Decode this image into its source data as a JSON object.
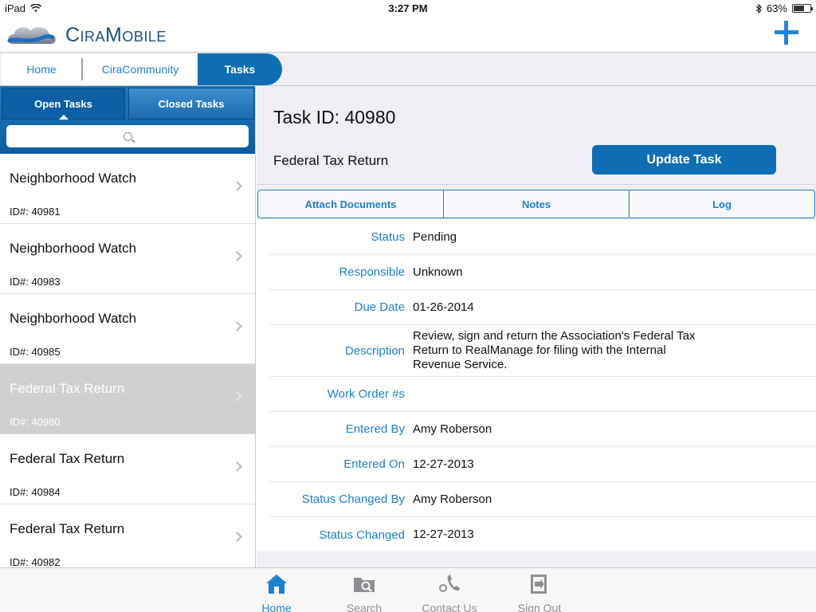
{
  "status_bar": {
    "device": "iPad",
    "time": "3:27 PM",
    "battery": "63%",
    "battery_level": 0.63
  },
  "app": {
    "name": "CiraMobile"
  },
  "top_tabs": [
    {
      "label": "Home"
    },
    {
      "label": "CiraCommunity"
    },
    {
      "label": "Tasks"
    }
  ],
  "segments": {
    "open": "Open Tasks",
    "closed": "Closed Tasks"
  },
  "tasks": [
    {
      "title": "Neighborhood Watch",
      "id_text": "ID#: 40981"
    },
    {
      "title": "Neighborhood Watch",
      "id_text": "ID#: 40983"
    },
    {
      "title": "Neighborhood Watch",
      "id_text": "ID#: 40985"
    },
    {
      "title": "Federal Tax Return",
      "id_text": "ID#: 40980",
      "selected": true
    },
    {
      "title": "Federal Tax Return",
      "id_text": "ID#: 40984"
    },
    {
      "title": "Federal Tax Return",
      "id_text": "ID#: 40982"
    }
  ],
  "detail": {
    "task_id": "Task ID: 40980",
    "task_name": "Federal Tax Return",
    "update_label": "Update Task",
    "subtabs": [
      "Attach Documents",
      "Notes",
      "Log"
    ],
    "fields": [
      {
        "label": "Status",
        "value": "Pending"
      },
      {
        "label": "Responsible",
        "value": "Unknown"
      },
      {
        "label": "Due Date",
        "value": "01-26-2014"
      },
      {
        "label": "Description",
        "value": "Review, sign and return the Association's Federal Tax Return to RealManage for filing with the Internal Revenue Service."
      },
      {
        "label": "Work Order #s",
        "value": ""
      },
      {
        "label": "Entered By",
        "value": "Amy Roberson"
      },
      {
        "label": "Entered On",
        "value": "12-27-2013"
      },
      {
        "label": "Status Changed By",
        "value": "Amy Roberson"
      },
      {
        "label": "Status Changed",
        "value": "12-27-2013"
      }
    ]
  },
  "tab_bar": [
    {
      "label": "Home",
      "icon": "home-icon",
      "active": true
    },
    {
      "label": "Search",
      "icon": "search-folder-icon"
    },
    {
      "label": "Contact Us",
      "icon": "phone-icon"
    },
    {
      "label": "Sign Out",
      "icon": "sign-out-icon"
    }
  ],
  "colors": {
    "accent": "#1e7fd0",
    "brand_dark": "#0f6db3"
  }
}
